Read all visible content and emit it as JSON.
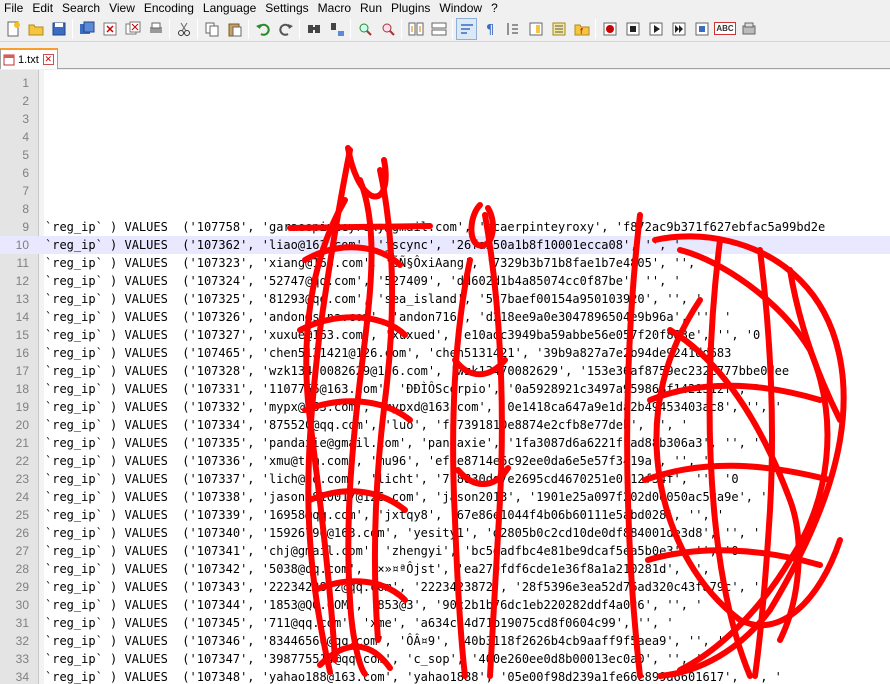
{
  "menu": [
    "File",
    "Edit",
    "Search",
    "View",
    "Encoding",
    "Language",
    "Settings",
    "Macro",
    "Run",
    "Plugins",
    "Window",
    "?"
  ],
  "toolbar": {
    "icons": [
      "new-file-icon",
      "open-file-icon",
      "save-icon",
      "save-all-icon",
      "close-icon",
      "close-all-icon",
      "print-icon",
      "cut-icon",
      "copy-icon",
      "paste-icon",
      "undo-icon",
      "redo-icon",
      "find-icon",
      "replace-icon",
      "zoom-in-icon",
      "zoom-out-icon",
      "sync-vertical-icon",
      "sync-horizontal-icon",
      "word-wrap-icon",
      "show-all-chars-icon",
      "indent-guide-icon",
      "document-map-icon",
      "function-list-icon",
      "folder-workspace-icon",
      "record-macro-icon",
      "stop-record-icon",
      "play-macro-icon",
      "play-multiple-icon",
      "save-macro-icon",
      "spellcheck-icon",
      "launch-icon"
    ],
    "spellcheck_label": "ABC"
  },
  "tab": {
    "label": "1.txt",
    "close_glyph": "✕"
  },
  "editor": {
    "lines": [
      {
        "n": "1",
        "text": ""
      },
      {
        "n": "2",
        "text": ""
      },
      {
        "n": "3",
        "text": ""
      },
      {
        "n": "4",
        "text": ""
      },
      {
        "n": "5",
        "text": ""
      },
      {
        "n": "6",
        "text": ""
      },
      {
        "n": "7",
        "text": ""
      },
      {
        "n": "8",
        "text": ""
      },
      {
        "n": "9",
        "text": "`reg_ip` ) VALUES  ('107758', 'garaeepinteyroxy@gmail.com', 'pcaerpinteyroxy', 'f872ac9b371f627ebfac5a99bd2e"
      },
      {
        "n": "10",
        "text": "`reg_ip` ) VALUES  ('107362', 'liao@163.com', 'jscync', '26fa250a1b8f10001ecca08', '', '"
      },
      {
        "n": "11",
        "text": "`reg_ip` ) VALUES  ('107323', 'xiang@163.com', 'ÕÑ§ÔxiAang', '7329b3b71b8fae1b7e4805', '', '"
      },
      {
        "n": "12",
        "text": "`reg_ip` ) VALUES  ('107324', '52747@qq.com', '527409', 'dd602d1b4a85074cc0f87be', '', '"
      },
      {
        "n": "13",
        "text": "`reg_ip` ) VALUES  ('107325', '81293@qq.com', 'sea_island', '5c7baef00154a950103920', '', '"
      },
      {
        "n": "14",
        "text": "`reg_ip` ) VALUES  ('107326', 'andon@sina.com', 'andon716', 'd218ee9a0e3047896504e9b96a', '', '"
      },
      {
        "n": "15",
        "text": "`reg_ip` ) VALUES  ('107327', 'xuxue@163.com', 'xuxued', 'e10adc3949ba59abbe56e057f20f883e', '', '0"
      },
      {
        "n": "16",
        "text": "`reg_ip` ) VALUES  ('107465', 'chen5131421@126.com', 'chen5131421', '39b9a827a7e2b94de9241dd683"
      },
      {
        "n": "17",
        "text": "`reg_ip` ) VALUES  ('107328', 'wzk13470082629@126.com', 'wzk13470082629', '153e36af8759ec232c777bbe0dee"
      },
      {
        "n": "18",
        "text": "`reg_ip` ) VALUES  ('107331', '1107756@163.com', 'ÐÐÌÔScorpio', '0a5928921c3497a959868f1421312f', '"
      },
      {
        "n": "19",
        "text": "`reg_ip` ) VALUES  ('107332', 'mypx@163.com', 'mypxd@163.com', '0e1418ca647a9e1da2b49453403ac8', '', '"
      },
      {
        "n": "20",
        "text": "`reg_ip` ) VALUES  ('107334', '875520@qq.com', 'luo', 'fd7391810e8874e2cfb8e77deb', '', '"
      },
      {
        "n": "21",
        "text": "`reg_ip` ) VALUES  ('107335', 'pandaxie@gmail.com', 'pandaxie', '1fa3087d6a6221f1ad88b306a3', '', '"
      },
      {
        "n": "22",
        "text": "`reg_ip` ) VALUES  ('107336', 'xmu@tom.com', 'mu96', 'ef2e8714e6c92ee0da6e5e57f3419a', '', '"
      },
      {
        "n": "23",
        "text": "`reg_ip` ) VALUES  ('107337', 'lich@qq.com', 'licht', '778830dd7e2695cd4670251e0112f34f', '', '0"
      },
      {
        "n": "24",
        "text": "`reg_ip` ) VALUES  ('107338', 'jason9810017@126.com', 'jason2013', '1901e25a097f202d06050ac58a9e', '"
      },
      {
        "n": "25",
        "text": "`reg_ip` ) VALUES  ('107339', '16958@qq.com', 'jxtqy8', '67e86e1044f4b06b60111e5abd028', '', '"
      },
      {
        "n": "26",
        "text": "`reg_ip` ) VALUES  ('107340', '15926790@163.com', 'yesity1', 'd2805b0c2cd10de0df884001de3d8', '', '"
      },
      {
        "n": "27",
        "text": "`reg_ip` ) VALUES  ('107341', 'chj@gmail.com', 'zhengyi', 'bc5dadfbc4e81be9dcaf5ea5b0e3', '', '0"
      },
      {
        "n": "28",
        "text": "`reg_ip` ) VALUES  ('107342', '5038@qq.com', '×»¤ªÔjst', 'ea270fdf6cde1e36f8a1a210281d', '', '"
      },
      {
        "n": "29",
        "text": "`reg_ip` ) VALUES  ('107343', '2223423872@qq.com', '2223423872', '28f5396e3ea52d76ad320c43fa79c', '', '"
      },
      {
        "n": "30",
        "text": "`reg_ip` ) VALUES  ('107344', '1853@QQ.COM', '853@3', '90c2b1b76dc1eb220282ddf4a026', '', '"
      },
      {
        "n": "31",
        "text": "`reg_ip` ) VALUES  ('107345', '711@qq.com', 'xme', 'a634c74d71b19075cd8f0604c99', '', '"
      },
      {
        "n": "32",
        "text": "`reg_ip` ) VALUES  ('107346', '83446566@qq.com', 'ÔÂ¤9', '40b3118f2626b4cb9aaff9f5aea9', '', '"
      },
      {
        "n": "33",
        "text": "`reg_ip` ) VALUES  ('107347', '398775514@qq.com', 'c_sop', '400e260ee0d8b00013ec0a0', '', '"
      },
      {
        "n": "34",
        "text": "`reg_ip` ) VALUES  ('107348', 'yahao188@163.com', 'yahao1888', '05e00f98d239a1fe66e899a6601617', '', '"
      }
    ],
    "current_line": "10"
  }
}
